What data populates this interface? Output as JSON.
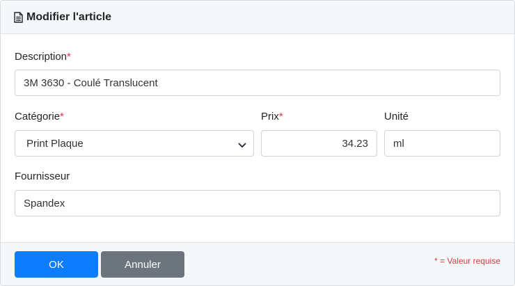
{
  "header": {
    "title": "Modifier l'article"
  },
  "form": {
    "required_marker": "*",
    "description": {
      "label": "Description",
      "value": "3M 3630 - Coulé Translucent"
    },
    "category": {
      "label": "Catégorie",
      "selected": "Print Plaque"
    },
    "price": {
      "label": "Prix",
      "value": "34.23"
    },
    "unit": {
      "label": "Unité",
      "value": "ml"
    },
    "supplier": {
      "label": "Fournisseur",
      "value": "Spandex"
    }
  },
  "footer": {
    "ok_label": "OK",
    "cancel_label": "Annuler",
    "required_note": "* = Valeur requise"
  },
  "colors": {
    "primary": "#0d7dfd",
    "secondary": "#6c757d",
    "danger": "#dc3545"
  }
}
